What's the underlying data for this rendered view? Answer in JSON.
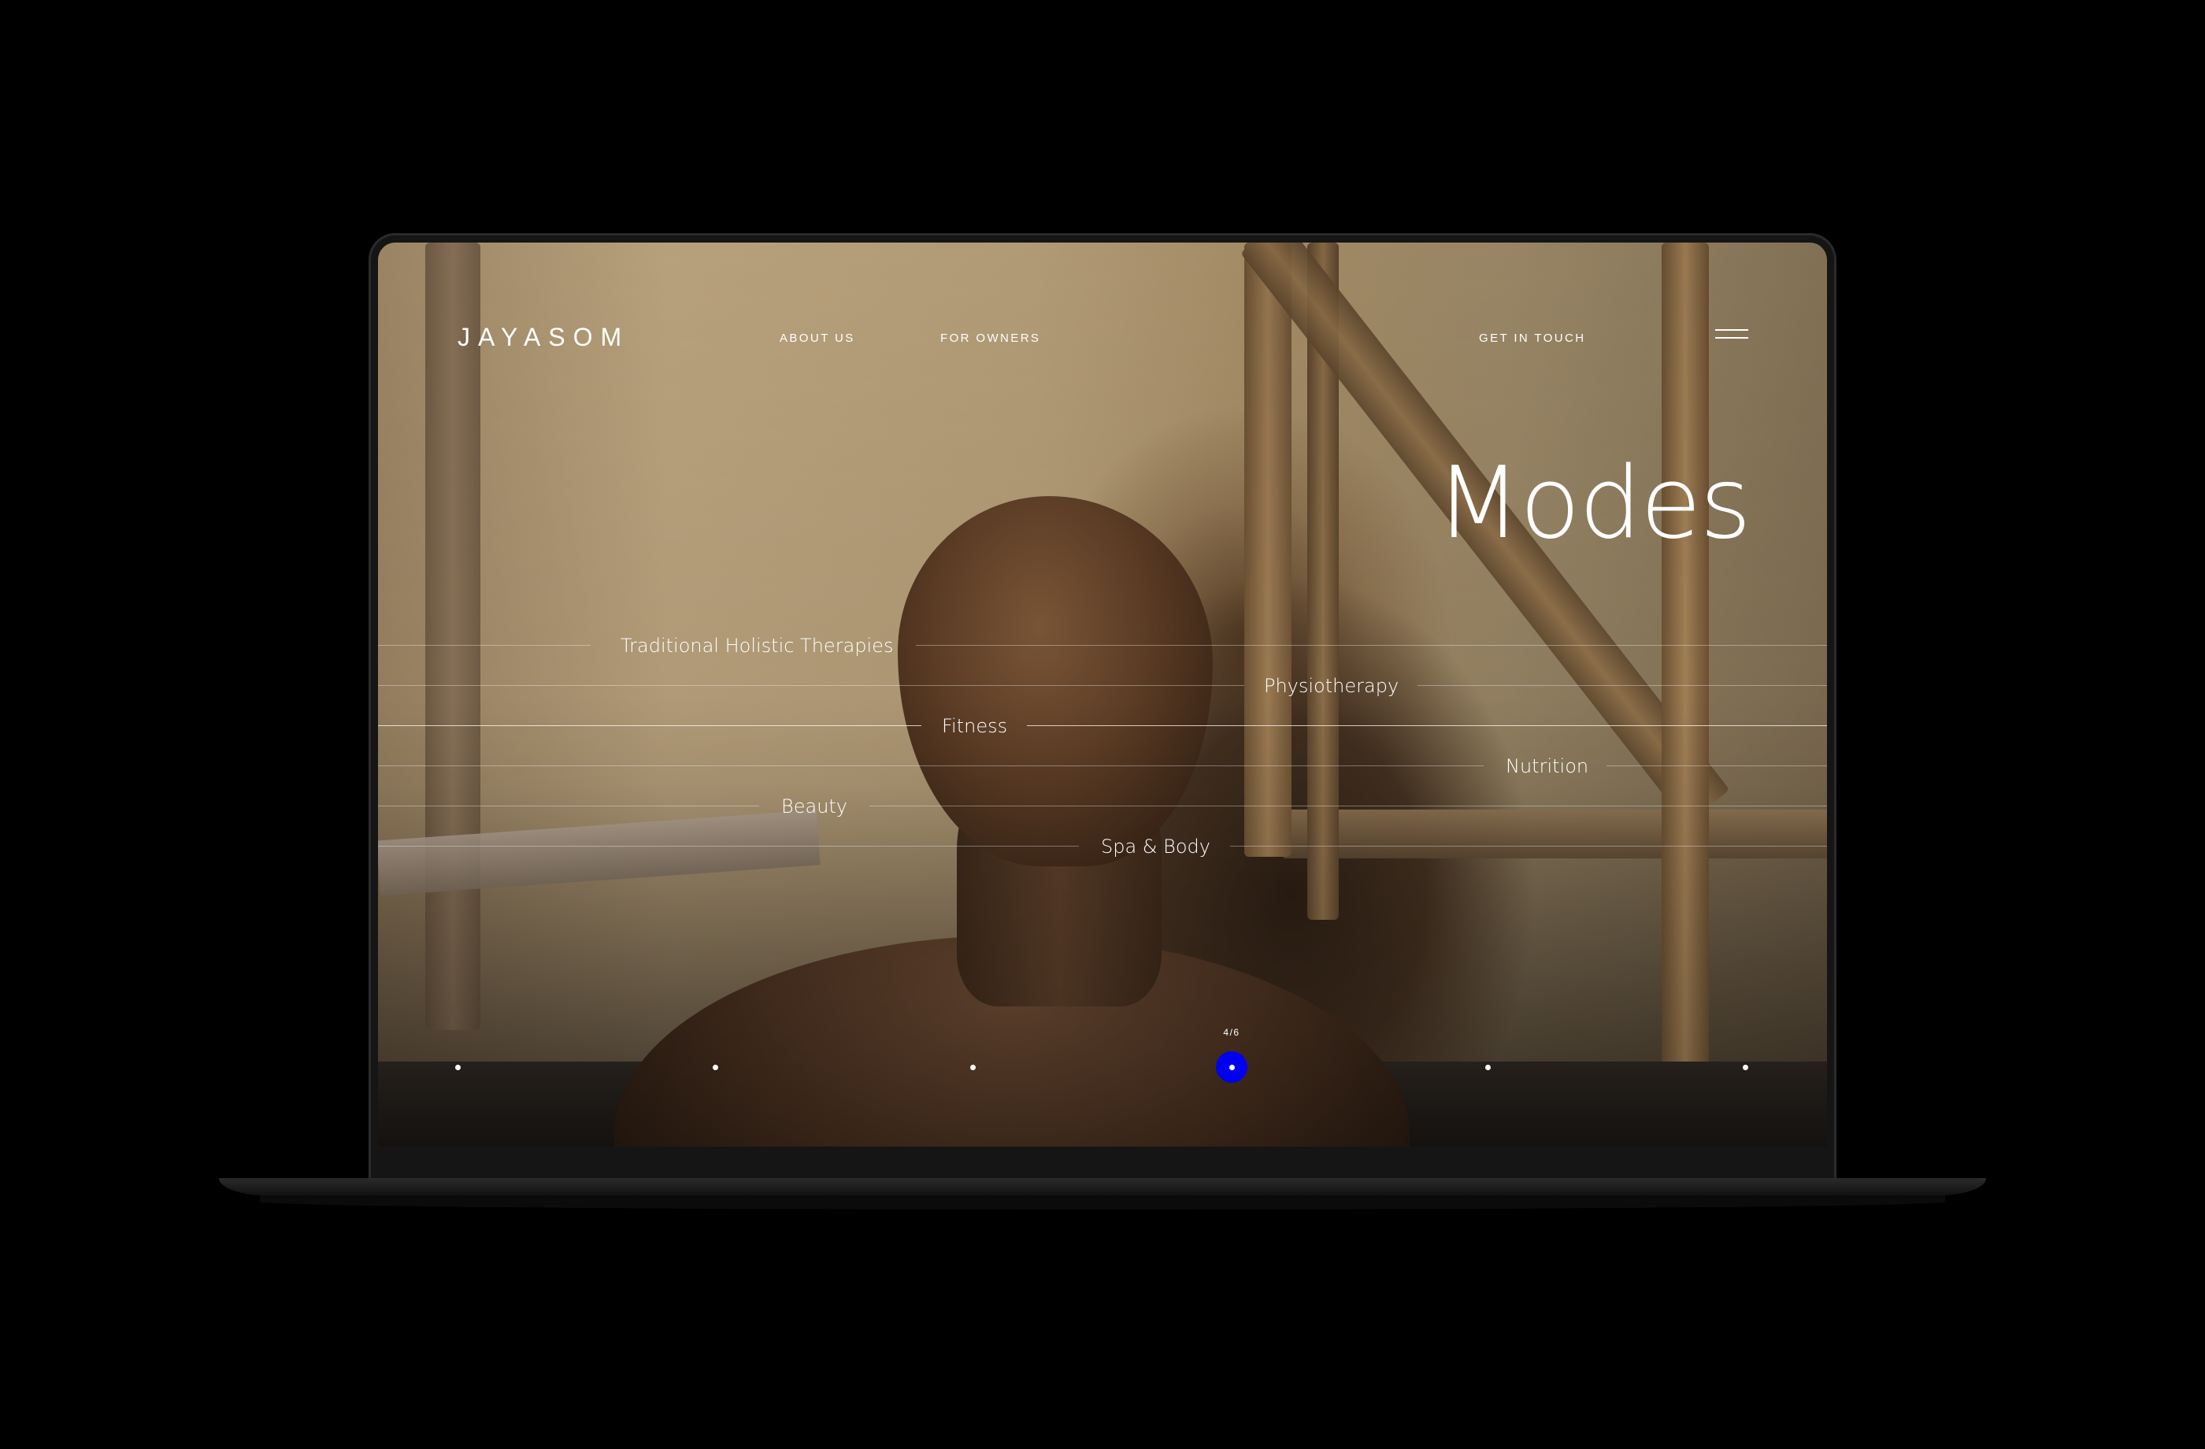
{
  "brand": {
    "logo": "JAYASOM"
  },
  "nav": {
    "about": "ABOUT US",
    "owners": "FOR OWNERS",
    "contact": "GET IN TOUCH"
  },
  "hero": {
    "title": "Modes"
  },
  "modes": [
    {
      "label": "Traditional Holistic Therapies"
    },
    {
      "label": "Physiotherapy"
    },
    {
      "label": "Fitness"
    },
    {
      "label": "Nutrition"
    },
    {
      "label": "Beauty"
    },
    {
      "label": "Spa & Body"
    }
  ],
  "pager": {
    "counter": "4/6",
    "current": 4,
    "total": 6
  },
  "colors": {
    "accent": "#0000ee",
    "text": "#ffffff",
    "background": "#000000"
  },
  "icons": {
    "menu": "hamburger-menu-icon"
  }
}
